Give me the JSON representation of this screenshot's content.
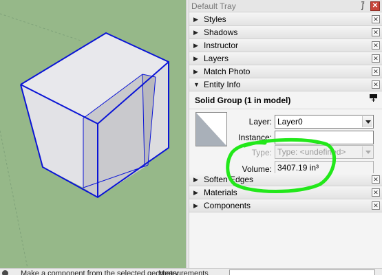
{
  "tray": {
    "title": "Default Tray",
    "pin_glyph": "⨛",
    "close_glyph": "✕"
  },
  "panels": {
    "styles": {
      "label": "Styles",
      "expanded": false
    },
    "shadows": {
      "label": "Shadows",
      "expanded": false
    },
    "instructor": {
      "label": "Instructor",
      "expanded": false
    },
    "layers": {
      "label": "Layers",
      "expanded": false
    },
    "match_photo": {
      "label": "Match Photo",
      "expanded": false
    },
    "entity_info": {
      "label": "Entity Info",
      "expanded": true
    },
    "soften_edges": {
      "label": "Soften Edges",
      "expanded": false
    },
    "materials": {
      "label": "Materials",
      "expanded": false
    },
    "components": {
      "label": "Components",
      "expanded": false
    }
  },
  "glyphs": {
    "collapsed": "▶",
    "expanded": "▼",
    "close": "✕"
  },
  "entity_info": {
    "title": "Solid Group (1 in model)",
    "layer_label": "Layer:",
    "layer_value": "Layer0",
    "instance_label": "Instance:",
    "instance_value": "",
    "type_label": "Type:",
    "type_value": "Type: <undefined>",
    "volume_label": "Volume:",
    "volume_value": "3407.19 in³"
  },
  "status_bar": {
    "text": "Make a component from the selected geometry",
    "measurements_label": "Measurements"
  },
  "colors": {
    "viewport_bg": "#96b889",
    "edge_blue": "#0a14d6",
    "highlight_green": "#22e81a",
    "face_light": "#e6e6ea",
    "face_dark": "#c8c8cc"
  },
  "icons": {
    "pin": "pin-icon",
    "tray_close": "close-icon",
    "material_swatch": "material-swatch-icon",
    "details_expand": "details-expand-icon",
    "status": "status-info-icon"
  }
}
